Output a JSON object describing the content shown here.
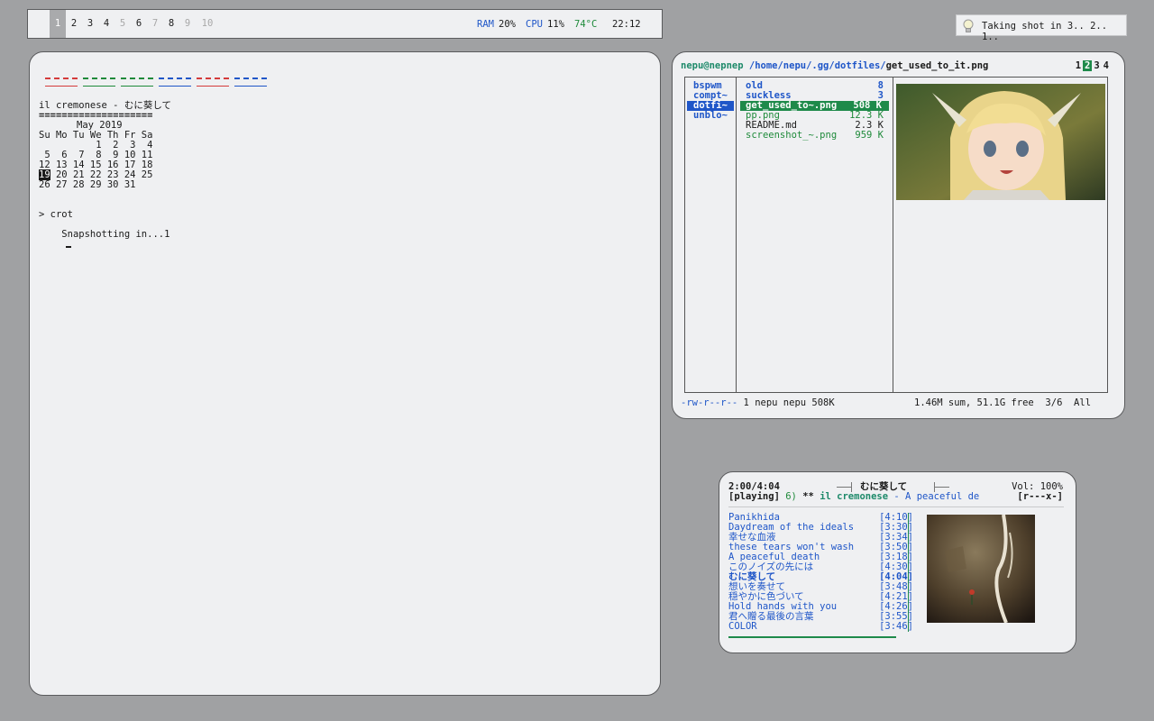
{
  "topbar": {
    "workspaces": [
      {
        "label": "1",
        "state": "active"
      },
      {
        "label": "2",
        "state": "occupied"
      },
      {
        "label": "3",
        "state": "occupied"
      },
      {
        "label": "4",
        "state": "occupied"
      },
      {
        "label": "5",
        "state": "empty"
      },
      {
        "label": "6",
        "state": "occupied"
      },
      {
        "label": "7",
        "state": "empty"
      },
      {
        "label": "8",
        "state": "occupied"
      },
      {
        "label": "9",
        "state": "empty"
      },
      {
        "label": "10",
        "state": "empty"
      }
    ],
    "ram_label": "RAM",
    "ram_value": "20%",
    "cpu_label": "CPU",
    "cpu_value": "11%",
    "temp": "74°C",
    "clock": "22:12"
  },
  "notification": {
    "icon": "lightbulb-icon",
    "text": "Taking shot in 3.. 2.. 1.."
  },
  "terminal": {
    "dashes_colors": [
      "#d43b3b",
      "#1e8a3a",
      "#1e8a3a",
      "#1f56c8",
      "#d43b3b",
      "#1f56c8"
    ],
    "now_playing": "il cremonese - むに葵して",
    "rule": "====================",
    "calendar": {
      "title": "May 2019",
      "weekdays": "Su Mo Tu We Th Fr Sa",
      "weeks": [
        "          1  2  3  4",
        " 5  6  7  8  9 10 11",
        "12 13 14 15 16 17 18",
        "19 20 21 22 23 24 25",
        "26 27 28 29 30 31"
      ],
      "today": "19"
    },
    "prompt": "> crot",
    "output": "Snapshotting in...1"
  },
  "ranger": {
    "user_host": "nepu@nepnep",
    "path": "/home/nepu/.gg/dotfiles/",
    "file": "get_used_to_it.png",
    "tabs": [
      "1",
      "2",
      "3",
      "4"
    ],
    "active_tab": "2",
    "parent_dirs": [
      "bspwm",
      "compt~",
      "dotfi~",
      "unblo~"
    ],
    "files": [
      {
        "name": "old",
        "size": "8",
        "kind": "dir"
      },
      {
        "name": "suckless",
        "size": "3",
        "kind": "dir"
      },
      {
        "name": "get_used_to~.png",
        "size": "508 K",
        "kind": "selected"
      },
      {
        "name": "pp.png",
        "size": "12.3 K",
        "kind": "image"
      },
      {
        "name": "README.md",
        "size": "2.3 K",
        "kind": "file"
      },
      {
        "name": "screenshot_~.png",
        "size": "959 K",
        "kind": "image"
      }
    ],
    "status_perms": "-rw-r--r--",
    "status_info": "1 nepu nepu 508K",
    "status_sum": "1.46M sum, 51.1G free",
    "status_pos": "3/6",
    "status_all": "All"
  },
  "player": {
    "time": "2:00/4:04",
    "title": "むに葵して",
    "volume": "Vol: 100%",
    "state": "[playing]",
    "track_no": "6)",
    "stars": "**",
    "artist": "il cremonese",
    "sep": "-",
    "song_title": "A peaceful de",
    "flags": "[r---x-]",
    "playlist": [
      {
        "name": "Panikhida",
        "dur": "[4:10]"
      },
      {
        "name": "Daydream of the ideals",
        "dur": "[3:30]"
      },
      {
        "name": "幸せな血液",
        "dur": "[3:34]"
      },
      {
        "name": "these tears won't wash",
        "dur": "[3:50]"
      },
      {
        "name": "A peaceful death",
        "dur": "[3:18]"
      },
      {
        "name": "このノイズの先には",
        "dur": "[4:30]"
      },
      {
        "name": "むに葵して",
        "dur": "[4:04]"
      },
      {
        "name": "想いを奏せて",
        "dur": "[3:48]"
      },
      {
        "name": "穏やかに色づいて",
        "dur": "[4:21]"
      },
      {
        "name": "Hold hands with you",
        "dur": "[4:26]"
      },
      {
        "name": "君へ贈る最後の言葉",
        "dur": "[3:55]"
      },
      {
        "name": "COLOR",
        "dur": "[3:46]"
      }
    ],
    "current_index": 6,
    "progress": 0.49
  }
}
